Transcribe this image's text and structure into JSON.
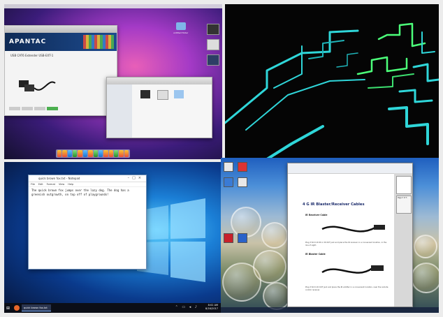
{
  "quad_mac": {
    "browser_banner": "APANTAC",
    "product_title": "USB CAT6 Extender USB-EXT-1",
    "desktop_folder_label": "untitled folder",
    "finder_items": [
      "",
      "",
      ""
    ]
  },
  "quad_pipes": {},
  "quad_win10": {
    "notepad_title": "quick brown fox.txt - Notepad",
    "menu": [
      "File",
      "Edit",
      "Format",
      "View",
      "Help"
    ],
    "body_text": "The quick brown fox jumps over the lazy dog. The dog has a greenish outgrowth, on top off of playgrounds!",
    "taskbar_app": "quick brown fox.txt",
    "tray_time": "8:02 AM",
    "tray_date": "8/16/2017"
  },
  "quad_win8": {
    "pdf_heading": "4 G IR Blaster/Receiver Cables",
    "section_receiver": "IR Receiver Cable",
    "section_blaster": "IR Blaster Cable",
    "para_receiver": "Plug 3.5mm IR IN or IR OUT jack and place the IR receiver in a convenient location, in the line of sight.",
    "para_blaster": "Plug 3.5mm IR OUT jack and place the IR emitter in a convenient location, near the remote control receiver.",
    "thumb_label": "Page 3 of 3"
  }
}
